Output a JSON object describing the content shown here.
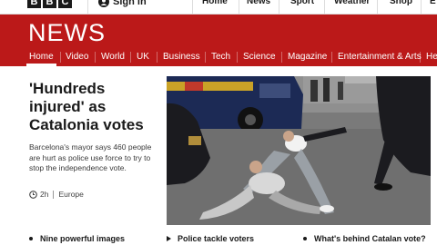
{
  "topbar": {
    "logo": [
      "B",
      "B",
      "C"
    ],
    "signin_label": "Sign in",
    "links": [
      "Home",
      "News",
      "Sport",
      "Weather",
      "Shop",
      "E"
    ]
  },
  "masthead": {
    "title": "NEWS",
    "nav": [
      "Home",
      "Video",
      "World",
      "UK",
      "Business",
      "Tech",
      "Science",
      "Magazine",
      "Entertainment & Arts",
      "He"
    ],
    "active": "Home"
  },
  "lead": {
    "headline": "'Hundreds injured' as Catalonia votes",
    "summary": "Barcelona's mayor says 460 people are hurt as police use force to try to stop the independence vote.",
    "time": "2h",
    "section": "Europe"
  },
  "photo": {
    "alt": "Police tackle voters",
    "colors": {
      "van": "#1c2a55",
      "road": "#6f6f6f",
      "uniform": "#1b1b1f"
    }
  },
  "related": [
    {
      "label": "Nine powerful images",
      "icon": "bullet-icon"
    },
    {
      "label": "Police tackle voters",
      "icon": "play-icon"
    },
    {
      "label": "What's behind Catalan vote?",
      "icon": "bullet-icon"
    }
  ],
  "colors": {
    "brand_red": "#bb1919",
    "text": "#1a1a1a"
  }
}
